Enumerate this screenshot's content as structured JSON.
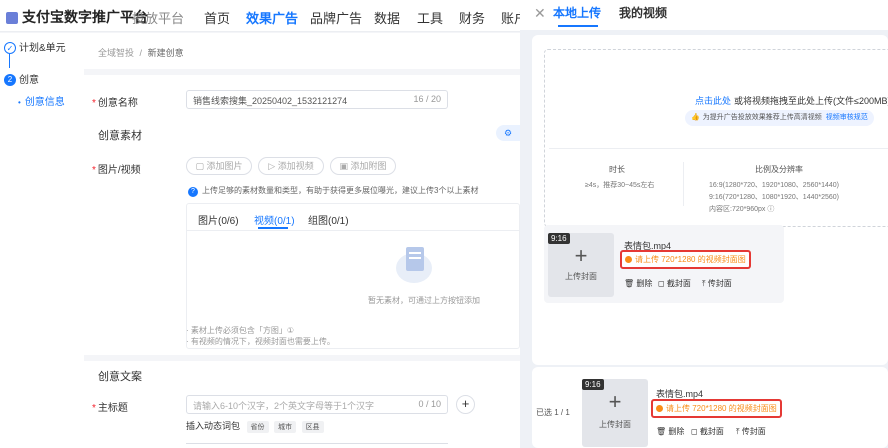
{
  "header": {
    "brand": "支付宝数字推广平台",
    "brand_sub": "投放平台",
    "nav": [
      "首页",
      "效果广告",
      "品牌广告",
      "数据",
      "工具",
      "财务",
      "账户"
    ],
    "active_nav": "效果广告"
  },
  "sidebar": {
    "steps": [
      {
        "label": "计划&单元",
        "state": "done"
      },
      {
        "label": "创意",
        "num": "2",
        "state": "active"
      },
      {
        "label": "创意信息",
        "state": "sub"
      }
    ]
  },
  "breadcrumb": {
    "parent": "全域智投",
    "sep": "/",
    "current": "新建创意"
  },
  "form": {
    "name_label": "创意名称",
    "name_value": "销售线索搜集_20250402_1532121274",
    "name_count": "16 / 20",
    "material_section": "创意素材",
    "media_label": "图片/视频",
    "add_image": "添加图片",
    "add_video": "添加视频",
    "add_attach": "添加附图",
    "tip": "上传足够的素材数量和类型，有助于获得更多展位曝光，建议上传3个以上素材",
    "tabs": [
      "图片(0/6)",
      "视频(0/1)",
      "组图(0/1)"
    ],
    "active_tab": "视频(0/1)",
    "empty_text": "暂无素材，可通过上方按钮添加",
    "note1": "· 素材上传必须包含「方图」①",
    "note2": "· 有视频的情况下，视频封面也需要上传。",
    "copy_section": "创意文案",
    "title_label": "主标题",
    "title_placeholder": "请输入6-10个汉字，2个英文字母等于1个汉字",
    "title_count": "0 / 10",
    "dynamic_label": "插入动态词包",
    "dynamic_tags": [
      "省份",
      "城市",
      "区县"
    ]
  },
  "panel": {
    "tabs": [
      "本地上传",
      "我的视频"
    ],
    "active_tab": "本地上传",
    "close_icon": "close-icon",
    "upload_link": "点击此处",
    "upload_text": "或将视频拖拽至此处上传(文件≤200MB)",
    "upload_tip": "为提升广告投放效果推荐上传高清视频",
    "upload_tip_link": "视频审核规范",
    "spec_duration_title": "时长",
    "spec_duration_value": "≥4s，推荐30~45s左右",
    "spec_ratio_title": "比例及分辨率",
    "spec_ratio_lines": [
      "16:9(1280*720、1920*1080、2560*1440)",
      "9:16(720*1280、1080*1920、1440*2560)",
      "内容区:720*960px ⓘ"
    ],
    "video_card": {
      "duration": "9:16",
      "upload_cover": "上传封面",
      "filename": "表情包.mp4",
      "warning": "请上传 720*1280 的视频封面图",
      "actions": [
        "删除",
        "截封面",
        "传封面"
      ]
    },
    "selected_label": "已选 1 / 1",
    "selected_card": {
      "duration": "9:16",
      "upload_cover": "上传封面",
      "filename": "表情包.mp4",
      "warning": "请上传 720*1280 的视频封面图",
      "actions": [
        "删除",
        "截封面",
        "传封面"
      ]
    }
  }
}
